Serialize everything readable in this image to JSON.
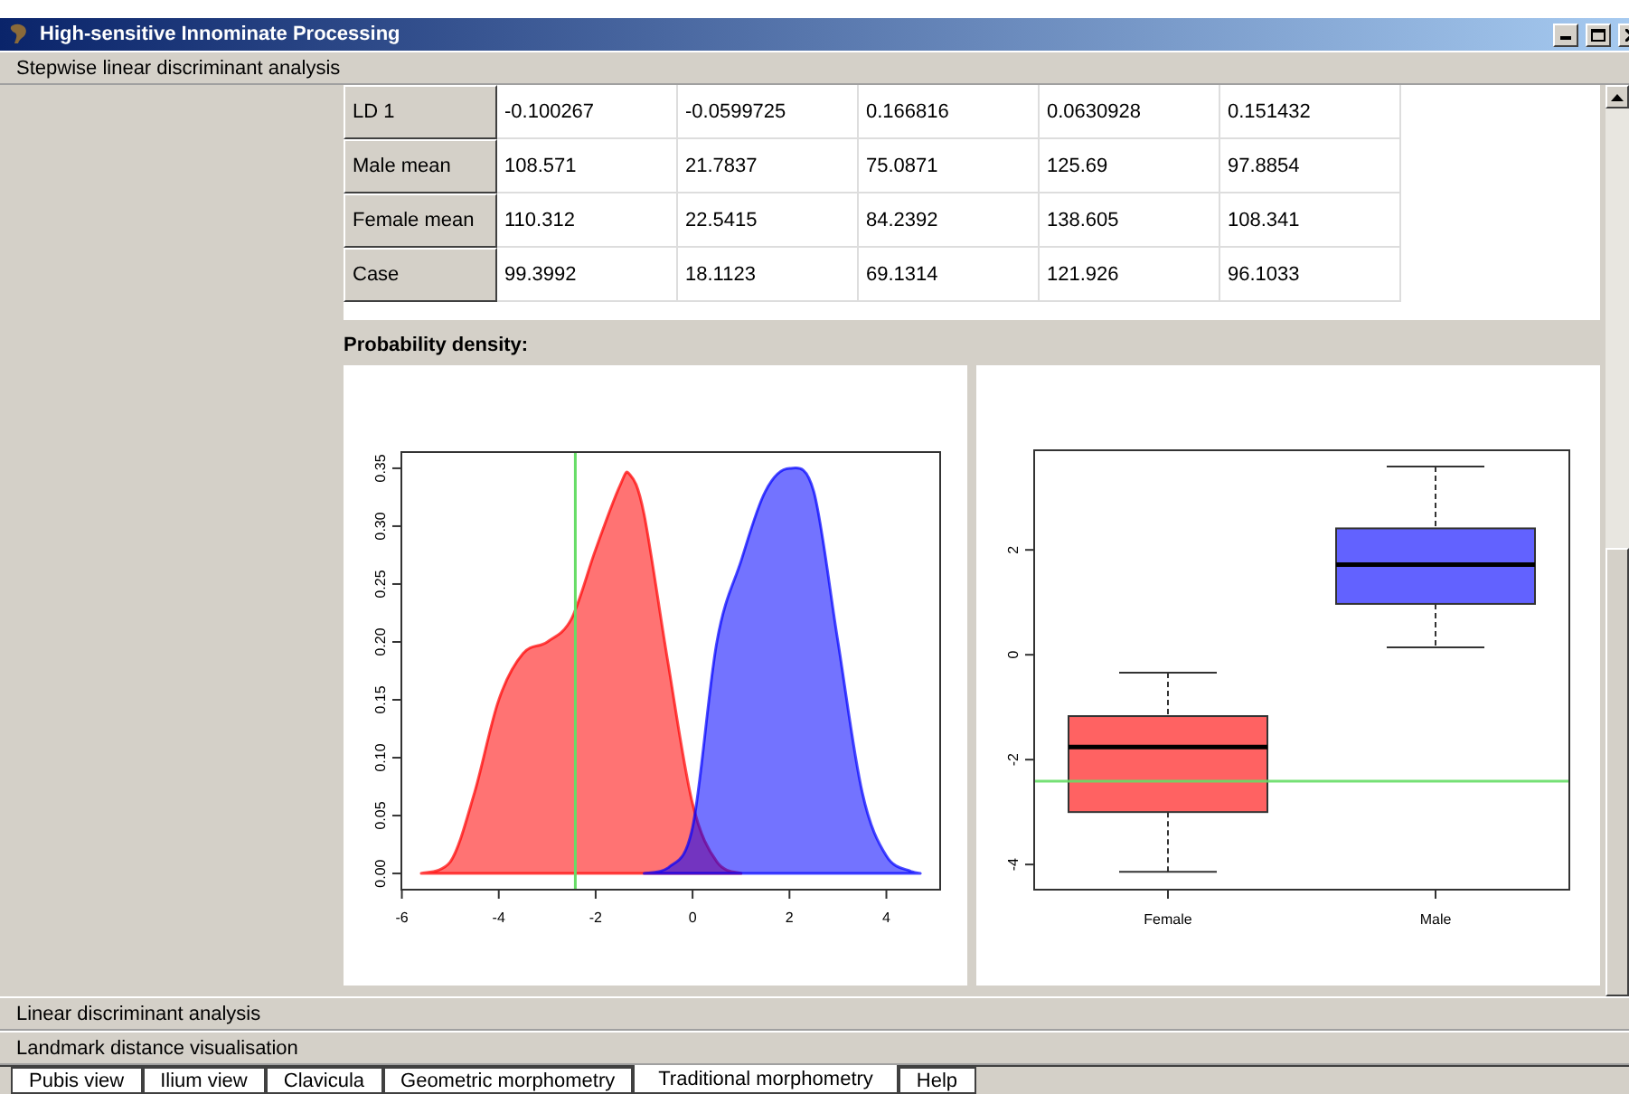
{
  "window": {
    "title": "High-sensitive Innominate Processing"
  },
  "sections": [
    {
      "title": "Stepwise linear discriminant analysis",
      "expanded": true,
      "table": {
        "rows": [
          {
            "header": "LD 1",
            "cells": [
              "-0.100267",
              "-0.0599725",
              "0.166816",
              "0.0630928",
              "0.151432"
            ]
          },
          {
            "header": "Male mean",
            "cells": [
              "108.571",
              "21.7837",
              "75.0871",
              "125.69",
              "97.8854"
            ]
          },
          {
            "header": "Female mean",
            "cells": [
              "110.312",
              "22.5415",
              "84.2392",
              "138.605",
              "108.341"
            ]
          },
          {
            "header": "Case",
            "cells": [
              "99.3992",
              "18.1123",
              "69.1314",
              "121.926",
              "96.1033"
            ]
          }
        ]
      },
      "charts_label": "Probability density:",
      "charts": [
        {
          "chart_data": {
            "type": "area",
            "x": [
              -5.6,
              -5,
              -4.5,
              -4,
              -3.5,
              -3,
              -2.5,
              -2,
              -1.5,
              -1.3,
              -1,
              -0.5,
              0,
              0.5,
              1,
              1.5,
              2,
              2.5,
              3,
              3.5,
              4,
              4.5,
              4.7
            ],
            "series": [
              {
                "color": "#ff0000",
                "values": [
                  0,
                  0.01,
                  0.07,
                  0.15,
                  0.19,
                  0.2,
                  0.22,
                  0.28,
                  0.335,
                  0.345,
                  0.31,
                  0.18,
                  0.06,
                  0.01,
                  0,
                  null,
                  null,
                  null,
                  null,
                  null,
                  null,
                  null,
                  null
                ]
              },
              {
                "color": "#0000ff",
                "values": [
                  null,
                  null,
                  null,
                  null,
                  null,
                  null,
                  null,
                  null,
                  null,
                  null,
                  0,
                  0.005,
                  0.04,
                  0.2,
                  0.27,
                  0.33,
                  0.35,
                  0.33,
                  0.2,
                  0.07,
                  0.015,
                  0.002,
                  0
                ]
              }
            ],
            "xlim": [
              -6.01,
              5.11
            ],
            "ylim": [
              -0.014,
              0.364
            ],
            "xticks": [
              -6,
              -4,
              -2,
              0,
              2,
              4
            ],
            "yticks": [
              {
                "value": 0,
                "label": "0.00"
              },
              {
                "value": 0.05,
                "label": "0.05"
              },
              {
                "value": 0.1,
                "label": "0.10"
              },
              {
                "value": 0.15,
                "label": "0.15"
              },
              {
                "value": 0.2,
                "label": "0.20"
              },
              {
                "value": 0.25,
                "label": "0.25"
              },
              {
                "value": 0.3,
                "label": "0.30"
              },
              {
                "value": 0.35,
                "label": "0.35"
              }
            ],
            "ref_lines": [
              {
                "axis": "x",
                "value": -2.42
              }
            ]
          }
        },
        {
          "box_plot": {
            "y_tick_labels": [
              "-4",
              "-2",
              "0",
              "2"
            ],
            "groups": [
              {
                "label": "Female",
                "color": "#ff6262"
              },
              {
                "label": "Male",
                "color": "#6262ff"
              }
            ]
          }
        }
      ]
    },
    {
      "title": "Linear discriminant analysis",
      "expanded": false
    },
    {
      "title": "Landmark distance visualisation",
      "expanded": false
    }
  ],
  "tabs": [
    {
      "label": "Pubis view",
      "selected": false
    },
    {
      "label": "Ilium view",
      "selected": false
    },
    {
      "label": "Clavicula",
      "selected": false
    },
    {
      "label": "Geometric morphometry",
      "selected": false
    },
    {
      "label": "Traditional morphometry",
      "selected": true
    },
    {
      "label": "Help",
      "selected": false
    }
  ]
}
